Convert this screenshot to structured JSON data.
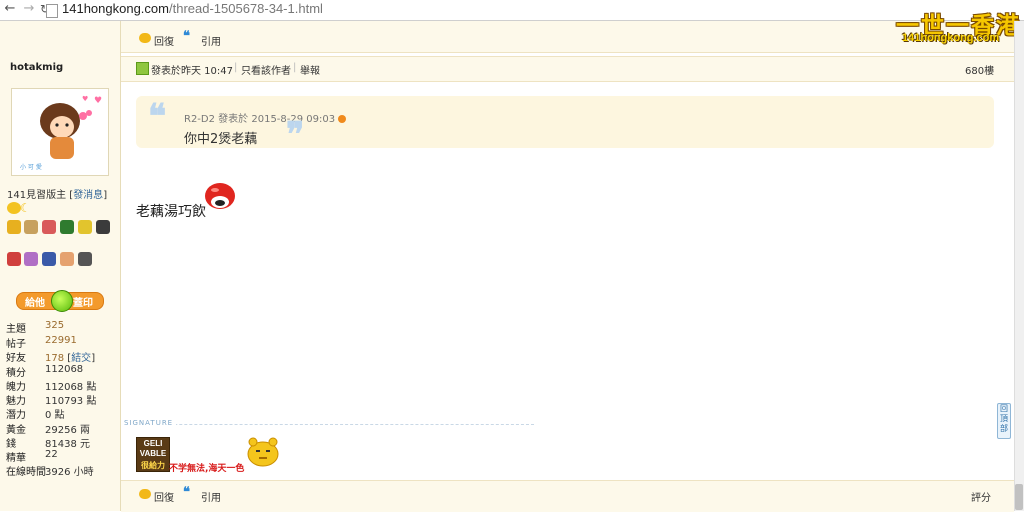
{
  "browser": {
    "url_host": "141hongkong.com",
    "url_path": "/thread-1505678-34-1.html"
  },
  "logo": {
    "chinese": "一世一香港",
    "english": "141hongkong.com"
  },
  "toolbar": {
    "reply_label": "回復",
    "quote_label": "引用"
  },
  "user": {
    "name": "hotakmig",
    "group": "141見習版主",
    "send_message": "發消息",
    "give_left": "給他",
    "give_right": "蓋印",
    "stats": [
      {
        "label": "主題",
        "value": "325"
      },
      {
        "label": "帖子",
        "value": "22991"
      },
      {
        "label": "好友",
        "value": "178",
        "extra": "結交"
      },
      {
        "label": "積分",
        "value": "112068"
      },
      {
        "label": "魄力",
        "value": "112068 點"
      },
      {
        "label": "魅力",
        "value": "110793 點"
      },
      {
        "label": "潛力",
        "value": "0 點"
      },
      {
        "label": "黃金",
        "value": "29256 兩"
      },
      {
        "label": "錢",
        "value": "81438 元"
      },
      {
        "label": "精華",
        "value": "22"
      },
      {
        "label": "在線時間",
        "value": "3926 小時"
      }
    ]
  },
  "post": {
    "posted_label": "發表於",
    "posted_time": "昨天 10:47",
    "only_author": "只看該作者",
    "report": "舉報",
    "floor": "680樓",
    "quote_author": "R2-D2",
    "quote_posted": "發表於",
    "quote_time": "2015-8-29 09:03",
    "quote_text": "你中2煲老藕",
    "body_text": "老藕湯巧飲",
    "rate": "評分"
  },
  "signature": {
    "label": "SIGNATURE",
    "badge_line1": "GELI",
    "badge_line2": "VABLE",
    "badge_line3": "很給力",
    "text": "不学無法,海天一色"
  },
  "backtop": {
    "label": "回頂部"
  },
  "colors": {
    "panel_bg": "#fdf9ea",
    "accent_orange": "#f39a2c",
    "quote_blue": "#2e89d6",
    "sig_red": "#d81b1b"
  }
}
